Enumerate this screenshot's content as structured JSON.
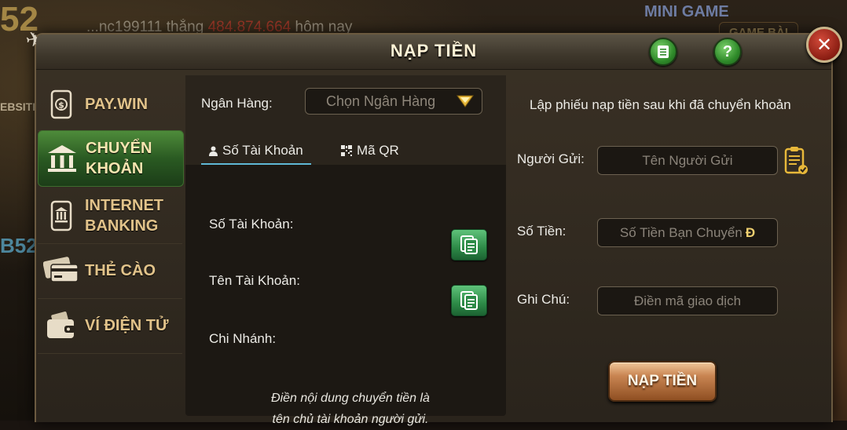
{
  "background": {
    "brand": "52",
    "ticker_prefix": "...nc199111",
    "ticker_mid": " thắng ",
    "ticker_amount": "484.874.664",
    "ticker_suffix": " hôm nay",
    "minigame": "MINI GAME",
    "gamebai": "GAME BÀI",
    "side_left": "EBSITE",
    "side_b52": "B52"
  },
  "dialog": {
    "title": "NẠP TIỀN",
    "history_icon": "list-icon",
    "help_label": "?",
    "close_label": "✕"
  },
  "sidebar": {
    "items": [
      {
        "label": "PAY.WIN",
        "icon": "dollar-phone-icon",
        "active": false
      },
      {
        "label": "CHUYỂN KHOẢN",
        "icon": "bank-icon",
        "active": true
      },
      {
        "label": "INTERNET BANKING",
        "icon": "mobile-bank-icon",
        "active": false
      },
      {
        "label": "THẺ CÀO",
        "icon": "card-icon",
        "active": false
      },
      {
        "label": "VÍ ĐIỆN TỬ",
        "icon": "wallet-icon",
        "active": false
      }
    ]
  },
  "bank_panel": {
    "bank_label": "Ngân Hàng:",
    "bank_select_placeholder": "Chọn Ngân Hàng",
    "tabs": [
      {
        "label": "Số Tài Khoản",
        "icon": "person-icon",
        "active": true
      },
      {
        "label": "Mã QR",
        "icon": "qr-icon",
        "active": false
      }
    ],
    "account_number_label": "Số Tài Khoản:",
    "account_name_label": "Tên Tài Khoản:",
    "branch_label": "Chi Nhánh:",
    "note_line1": "Điền nội dung chuyển tiền là",
    "note_line2": "tên chủ tài khoản người gửi."
  },
  "form": {
    "heading": "Lập phiếu nạp tiền sau khi đã chuyển khoản",
    "sender_label": "Người Gửi:",
    "sender_placeholder": "Tên Người Gửi",
    "amount_label": "Số Tiền:",
    "amount_placeholder": "Số Tiền Bạn Chuyển",
    "currency_symbol": "Đ",
    "note_label": "Ghi Chú:",
    "note_placeholder": "Điền mã giao dịch",
    "submit_label": "NẠP TIỀN"
  },
  "colors": {
    "accent_green": "#2d8a47",
    "gold_text": "#e2c38a",
    "tab_underline": "#5fb8d6",
    "ticker_amount": "#e23b2e"
  }
}
